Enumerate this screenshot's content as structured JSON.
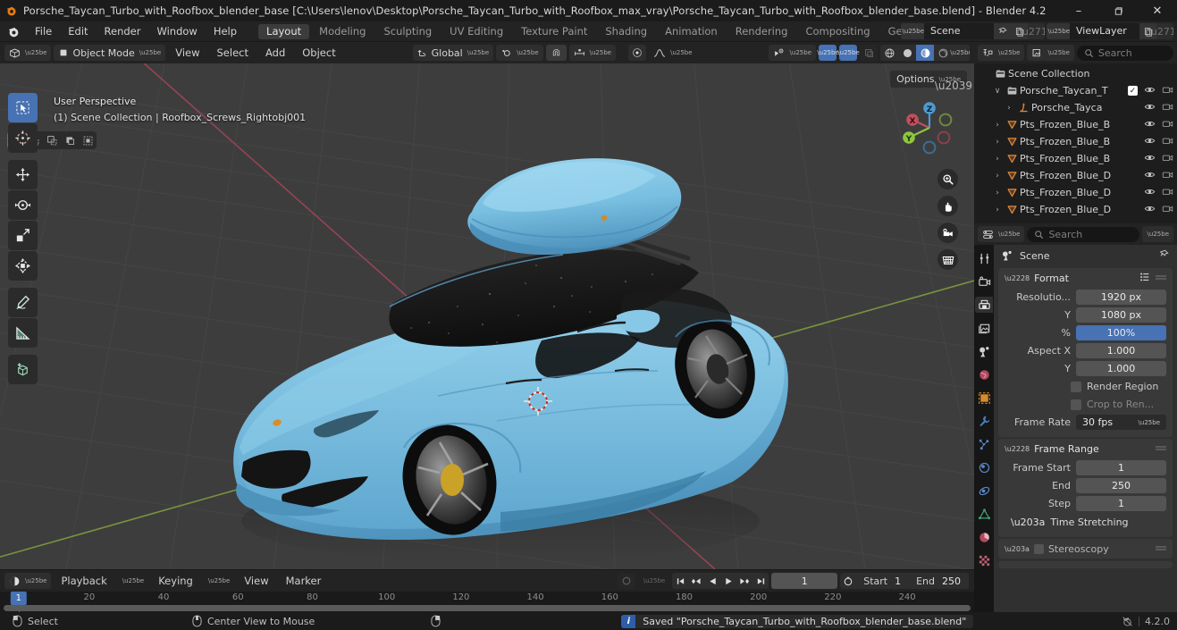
{
  "window": {
    "title": "Porsche_Taycan_Turbo_with_Roofbox_blender_base [C:\\Users\\lenov\\Desktop\\Porsche_Taycan_Turbo_with_Roofbox_max_vray\\Porsche_Taycan_Turbo_with_Roofbox_blender_base.blend] - Blender 4.2",
    "minimize": "–",
    "maximize": "❐",
    "close": "✕"
  },
  "topbar": {
    "menus": [
      "File",
      "Edit",
      "Render",
      "Window",
      "Help"
    ],
    "workspaces": [
      {
        "label": "Layout",
        "active": true
      },
      {
        "label": "Modeling",
        "active": false
      },
      {
        "label": "Sculpting",
        "active": false
      },
      {
        "label": "UV Editing",
        "active": false
      },
      {
        "label": "Texture Paint",
        "active": false
      },
      {
        "label": "Shading",
        "active": false
      },
      {
        "label": "Animation",
        "active": false
      },
      {
        "label": "Rendering",
        "active": false
      },
      {
        "label": "Compositing",
        "active": false
      },
      {
        "label": "Geometry Nod",
        "active": false
      }
    ],
    "scene_name": "Scene",
    "viewlayer_name": "ViewLayer"
  },
  "viewport_header": {
    "editor_type": "editor-type-3dview",
    "mode": "Object Mode",
    "menus": [
      "View",
      "Select",
      "Add",
      "Object"
    ],
    "transform_orientation": "Global",
    "options_label": "Options"
  },
  "viewport": {
    "perspective": "User Perspective",
    "breadcrumb": "(1) Scene Collection | Roofbox_Screws_Rightobj001",
    "gizmo_axes": [
      "X",
      "Y",
      "Z"
    ],
    "background_color": "#3d3d3d",
    "car_color": "#6fb3d9",
    "roofbox_color": "#74b8dd"
  },
  "outliner": {
    "search_placeholder": "Search",
    "rows": [
      {
        "label": "Scene Collection",
        "icon": "collection-icon",
        "indent": 0,
        "twisty": "",
        "checkbox": false,
        "eye": false,
        "camera": false
      },
      {
        "label": "Porsche_Taycan_T",
        "icon": "collection-icon",
        "indent": 1,
        "twisty": "∨",
        "checkbox": true,
        "eye": true,
        "camera": true
      },
      {
        "label": "Porsche_Tayca",
        "icon": "empty-axes-icon",
        "indent": 2,
        "twisty": "›",
        "checkbox": false,
        "eye": true,
        "camera": true
      },
      {
        "label": "Pts_Frozen_Blue_B",
        "icon": "mesh-icon",
        "indent": 1,
        "twisty": "›",
        "checkbox": false,
        "eye": true,
        "camera": true
      },
      {
        "label": "Pts_Frozen_Blue_B",
        "icon": "mesh-icon",
        "indent": 1,
        "twisty": "›",
        "checkbox": false,
        "eye": true,
        "camera": true
      },
      {
        "label": "Pts_Frozen_Blue_B",
        "icon": "mesh-icon",
        "indent": 1,
        "twisty": "›",
        "checkbox": false,
        "eye": true,
        "camera": true
      },
      {
        "label": "Pts_Frozen_Blue_D",
        "icon": "mesh-icon",
        "indent": 1,
        "twisty": "›",
        "checkbox": false,
        "eye": true,
        "camera": true
      },
      {
        "label": "Pts_Frozen_Blue_D",
        "icon": "mesh-icon",
        "indent": 1,
        "twisty": "›",
        "checkbox": false,
        "eye": true,
        "camera": true
      },
      {
        "label": "Pts_Frozen_Blue_D",
        "icon": "mesh-icon",
        "indent": 1,
        "twisty": "›",
        "checkbox": false,
        "eye": true,
        "camera": true
      }
    ]
  },
  "properties": {
    "search_placeholder": "Search",
    "breadcrumb": "Scene",
    "tabs": [
      "tool-icon",
      "render-icon",
      "output-icon",
      "viewlayer-icon",
      "scene-icon",
      "world-icon",
      "object-icon",
      "modifier-icon",
      "particles-icon",
      "physics-icon",
      "constraint-icon",
      "data-icon",
      "material-icon",
      "texture-icon"
    ],
    "active_tab_index": 2,
    "format": {
      "title": "Format",
      "rows": [
        {
          "label": "Resolutio...",
          "value": "1920 px",
          "highlight": false
        },
        {
          "label": "Y",
          "value": "1080 px",
          "highlight": false
        },
        {
          "label": "%",
          "value": "100%",
          "highlight": true
        },
        {
          "label": "Aspect X",
          "value": "1.000",
          "highlight": false
        },
        {
          "label": "Y",
          "value": "1.000",
          "highlight": false
        }
      ],
      "checkboxes": [
        {
          "label": "Render Region",
          "checked": false,
          "dim": false
        },
        {
          "label": "Crop to Ren...",
          "checked": false,
          "dim": true
        }
      ],
      "frame_rate_label": "Frame Rate",
      "frame_rate_value": "30 fps"
    },
    "frame_range": {
      "title": "Frame Range",
      "rows": [
        {
          "label": "Frame Start",
          "value": "1"
        },
        {
          "label": "End",
          "value": "250"
        },
        {
          "label": "Step",
          "value": "1"
        }
      ],
      "time_stretching": "Time Stretching"
    },
    "stereoscopy": "Stereoscopy"
  },
  "timeline": {
    "editor_icon": "timeline-icon",
    "menus": [
      "Playback",
      "Keying",
      "View",
      "Marker"
    ],
    "current_frame": "1",
    "start_label": "Start",
    "start_value": "1",
    "end_label": "End",
    "end_value": "250",
    "ticks": [
      {
        "label": "20",
        "frame": 20
      },
      {
        "label": "40",
        "frame": 40
      },
      {
        "label": "60",
        "frame": 60
      },
      {
        "label": "80",
        "frame": 80
      },
      {
        "label": "100",
        "frame": 100
      },
      {
        "label": "120",
        "frame": 120
      },
      {
        "label": "140",
        "frame": 140
      },
      {
        "label": "160",
        "frame": 160
      },
      {
        "label": "180",
        "frame": 180
      },
      {
        "label": "200",
        "frame": 200
      },
      {
        "label": "220",
        "frame": 220
      },
      {
        "label": "240",
        "frame": 240
      }
    ],
    "playhead_frame": "1"
  },
  "statusbar": {
    "items": [
      {
        "mouse": "left-mouse-icon",
        "label": "Select"
      },
      {
        "mouse": "middle-mouse-icon",
        "label": "Center View to Mouse"
      },
      {
        "mouse": "right-mouse-icon",
        "label": ""
      }
    ],
    "report": "Saved \"Porsche_Taycan_Turbo_with_Roofbox_blender_base.blend\"",
    "report_badge": "i",
    "version": "4.2.0"
  }
}
